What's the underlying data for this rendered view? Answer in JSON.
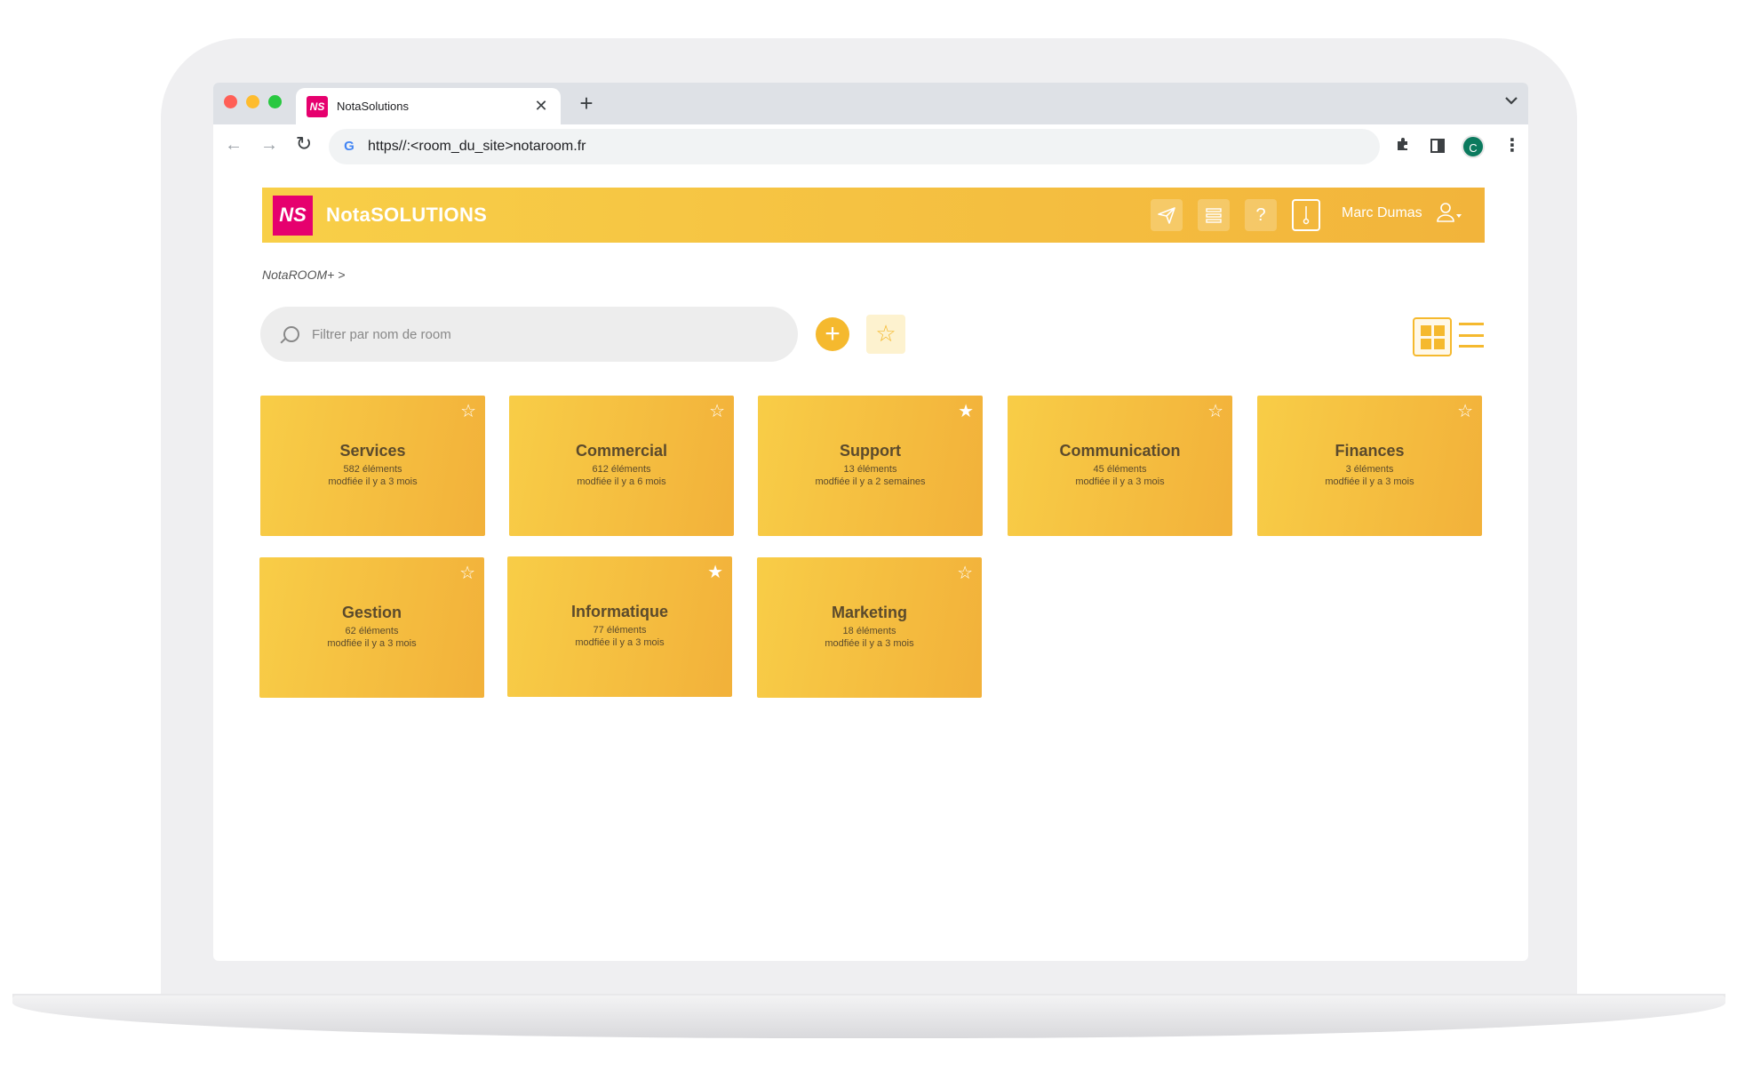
{
  "browser": {
    "tab_title": "NotaSolutions",
    "tab_favicon_text": "NS",
    "close_glyph": "✕",
    "new_tab_glyph": "+",
    "url": "https//:<room_du_site>notaroom.fr",
    "profile_initial": "C"
  },
  "app": {
    "logo_text": "NS",
    "title": "NotaSOLUTIONS",
    "user_name": "Marc Dumas",
    "header_icons": [
      "send-icon",
      "settings-icon",
      "help-icon",
      "room-icon",
      "user-icon"
    ]
  },
  "breadcrumb": "NotaROOM+ >",
  "search": {
    "placeholder": "Filtrer par nom de room"
  },
  "rooms": [
    {
      "name": "Services",
      "count": "582 éléments",
      "modified": "modfiée il  y a 3 mois",
      "favorite": false
    },
    {
      "name": "Commercial",
      "count": "612 éléments",
      "modified": "modfiée il  y a 6 mois",
      "favorite": false
    },
    {
      "name": "Support",
      "count": "13 éléments",
      "modified": "modfiée il  y a 2 semaines",
      "favorite": true
    },
    {
      "name": "Communication",
      "count": "45 éléments",
      "modified": "modfiée il  y a 3 mois",
      "favorite": false
    },
    {
      "name": "Finances",
      "count": "3 éléments",
      "modified": "modfiée il  y a 3 mois",
      "favorite": false
    },
    {
      "name": "Gestion",
      "count": "62 éléments",
      "modified": "modfiée il  y a 3 mois",
      "favorite": false
    },
    {
      "name": "Informatique",
      "count": "77 éléments",
      "modified": "modfiée il  y a 3 mois",
      "favorite": true
    },
    {
      "name": "Marketing",
      "count": "18 éléments",
      "modified": "modfiée il  y a 3 mois",
      "favorite": false
    }
  ],
  "colors": {
    "accent": "#f5b92e",
    "header_start": "#f8cf48",
    "header_end": "#f2b43b",
    "brand_logo": "#e6006e"
  }
}
